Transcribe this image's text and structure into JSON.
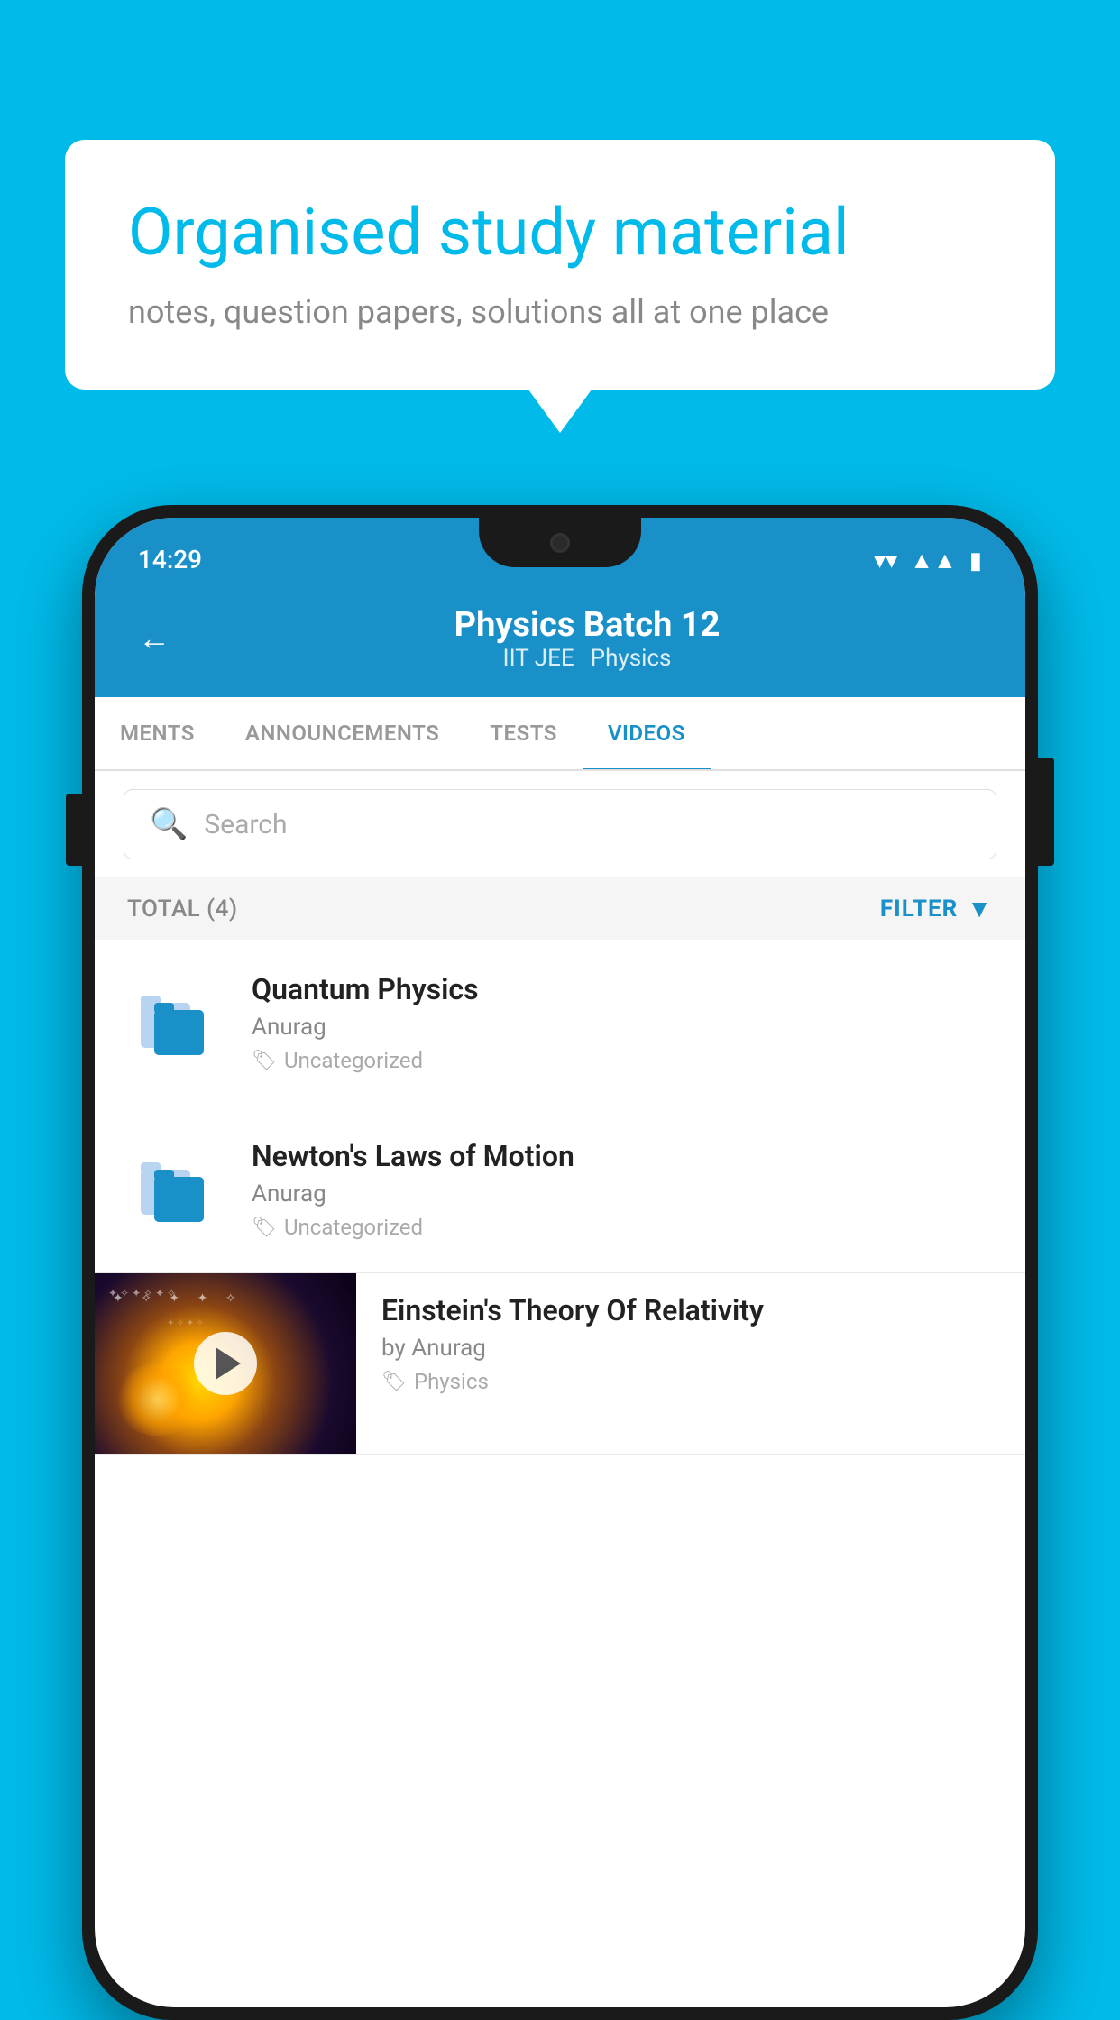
{
  "background_color": "#00BBEA",
  "speech_bubble": {
    "heading": "Organised study material",
    "subtext": "notes, question papers, solutions all at one place"
  },
  "phone": {
    "status_bar": {
      "time": "14:29",
      "wifi": "▼",
      "signal": "▲",
      "battery": "▮"
    },
    "header": {
      "back_label": "←",
      "title": "Physics Batch 12",
      "subtitle_part1": "IIT JEE",
      "subtitle_part2": "Physics"
    },
    "tabs": [
      {
        "label": "MENTS",
        "active": false
      },
      {
        "label": "ANNOUNCEMENTS",
        "active": false
      },
      {
        "label": "TESTS",
        "active": false
      },
      {
        "label": "VIDEOS",
        "active": true
      }
    ],
    "search": {
      "placeholder": "Search"
    },
    "filter_row": {
      "total_label": "TOTAL (4)",
      "filter_label": "FILTER"
    },
    "videos": [
      {
        "title": "Quantum Physics",
        "author": "Anurag",
        "tag": "Uncategorized",
        "has_thumbnail": false
      },
      {
        "title": "Newton's Laws of Motion",
        "author": "Anurag",
        "tag": "Uncategorized",
        "has_thumbnail": false
      },
      {
        "title": "Einstein's Theory Of Relativity",
        "author": "by Anurag",
        "tag": "Physics",
        "has_thumbnail": true
      }
    ]
  }
}
